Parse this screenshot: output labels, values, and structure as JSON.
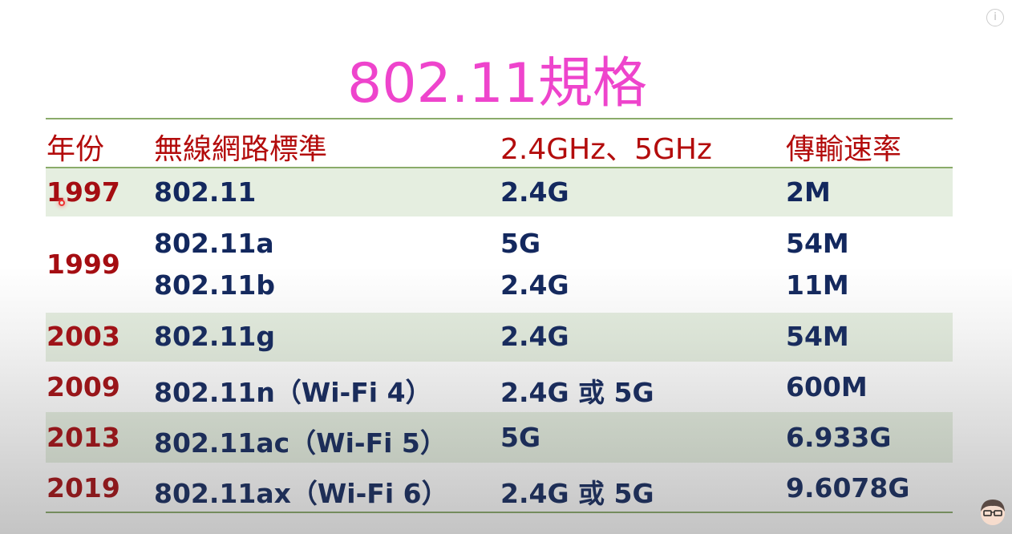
{
  "title": "802.11規格",
  "headers": [
    "年份",
    "無線網路標準",
    "2.4GHz、5GHz",
    "傳輸速率"
  ],
  "rows": [
    {
      "year": "1997",
      "standard": [
        "802.11"
      ],
      "band": [
        "2.4G"
      ],
      "speed": [
        "2M"
      ]
    },
    {
      "year": "1999",
      "standard": [
        "802.11a",
        "802.11b"
      ],
      "band": [
        "5G",
        "2.4G"
      ],
      "speed": [
        "54M",
        "11M"
      ]
    },
    {
      "year": "2003",
      "standard": [
        "802.11g"
      ],
      "band": [
        "2.4G"
      ],
      "speed": [
        "54M"
      ]
    },
    {
      "year": "2009",
      "standard": [
        "802.11n（Wi-Fi 4）"
      ],
      "band": [
        "2.4G 或 5G"
      ],
      "speed": [
        "600M"
      ]
    },
    {
      "year": "2013",
      "standard": [
        "802.11ac（Wi-Fi 5）"
      ],
      "band": [
        "5G"
      ],
      "speed": [
        "6.933G"
      ]
    },
    {
      "year": "2019",
      "standard": [
        "802.11ax（Wi-Fi 6）"
      ],
      "band": [
        "2.4G 或 5G"
      ],
      "speed": [
        "9.6078G"
      ]
    }
  ],
  "info_label": "i",
  "colors": {
    "title": "#ee44cc",
    "header": "#b30c0c",
    "year": "#a50d12",
    "value": "#13285e",
    "shade": "#e5eee0",
    "rule": "#8aab6a"
  }
}
